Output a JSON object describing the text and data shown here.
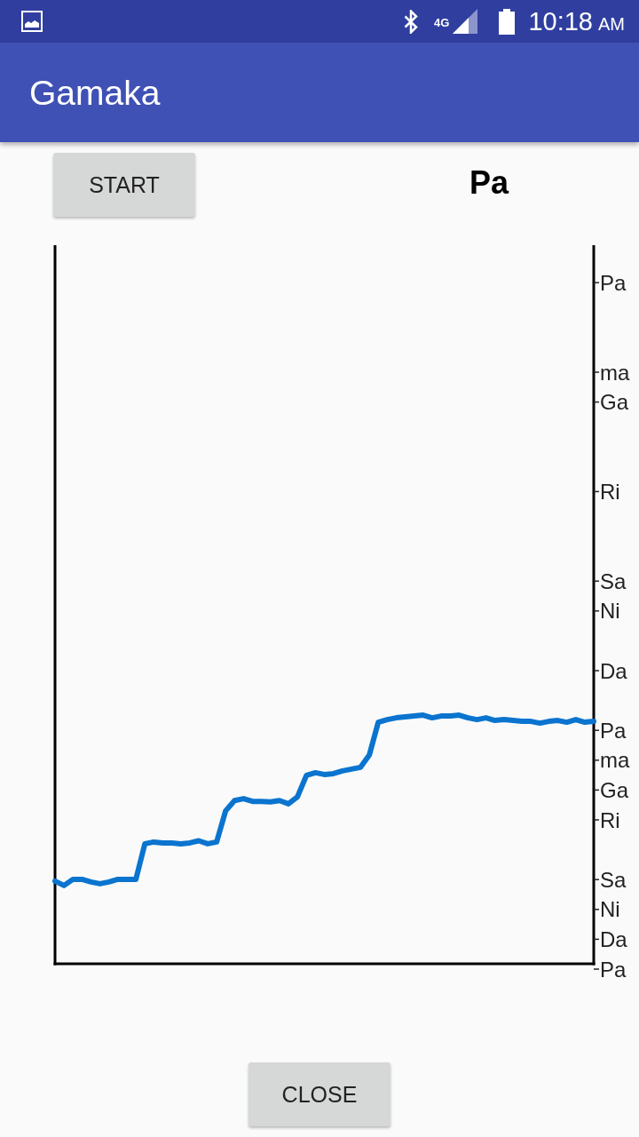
{
  "status_bar": {
    "network": "4G",
    "time": "10:18",
    "period": "AM"
  },
  "app_bar": {
    "title": "Gamaka"
  },
  "start_button": {
    "label": "START"
  },
  "current_note": "Pa",
  "pitch_graph": {
    "note_labels": [
      "Pa",
      "ma",
      "Ga",
      "Ri",
      "Sa",
      "Ni",
      "Da",
      "Pa",
      "ma",
      "Ga",
      "Ri",
      "Sa",
      "Ni",
      "Da",
      "Pa"
    ]
  },
  "close_button": {
    "label": "CLOSE"
  }
}
